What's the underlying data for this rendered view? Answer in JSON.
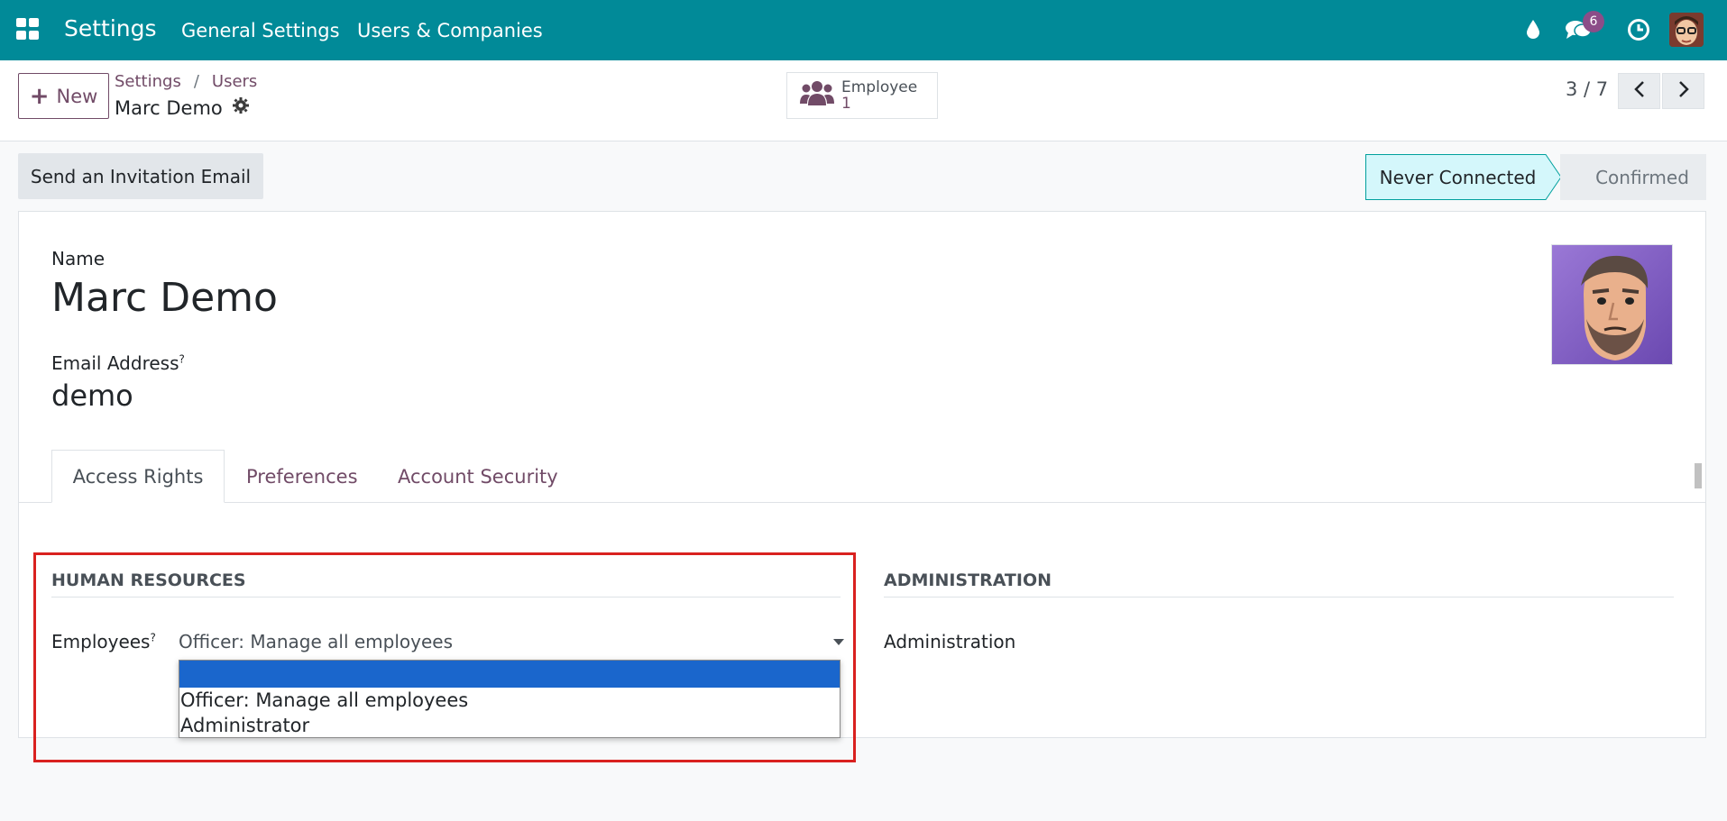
{
  "navbar": {
    "brand": "Settings",
    "menu": [
      "General Settings",
      "Users & Companies"
    ],
    "messages_count": "6",
    "icons": [
      "apps-icon",
      "droplet-icon",
      "chat-icon",
      "clock-icon"
    ]
  },
  "control_panel": {
    "new_label": "New",
    "breadcrumb": [
      "Settings",
      "Users"
    ],
    "breadcrumb_sep": "/",
    "record_title": "Marc Demo",
    "smart_button": {
      "label": "Employee",
      "count": "1"
    },
    "pager": "3 / 7"
  },
  "statusbar": {
    "invite_label": "Send an Invitation Email",
    "stages": [
      "Never Connected",
      "Confirmed"
    ],
    "current_stage": "Never Connected"
  },
  "form": {
    "name_label": "Name",
    "name_value": "Marc Demo",
    "email_label": "Email Address",
    "email_help": "?",
    "email_value": "demo"
  },
  "tabs": [
    "Access Rights",
    "Preferences",
    "Account Security"
  ],
  "active_tab": "Access Rights",
  "groups": {
    "hr": {
      "title": "HUMAN RESOURCES",
      "employees_label": "Employees",
      "employees_help": "?",
      "employees_value": "Officer: Manage all employees",
      "options": [
        "",
        "Officer: Manage all employees",
        "Administrator"
      ]
    },
    "admin": {
      "title": "ADMINISTRATION",
      "field_label": "Administration"
    }
  },
  "colors": {
    "navbar": "#018a98",
    "brand_purple": "#714b67",
    "status_current": "#d4f7fb",
    "highlight": "#d9211f",
    "selected_option": "#1a66cc"
  }
}
